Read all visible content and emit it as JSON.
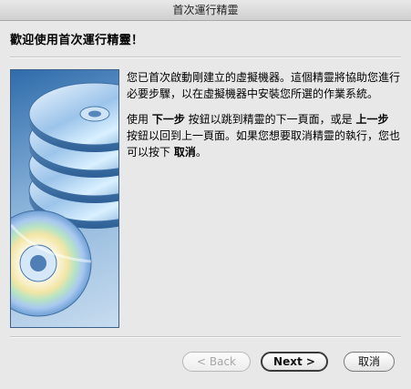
{
  "window": {
    "title": "首次運行精靈"
  },
  "header": {
    "title": "歡迎使用首次運行精靈！"
  },
  "body": {
    "paragraph1": "您已首次啟動剛建立的虛擬機器。這個精靈將協助您進行必要步驟，以在虛擬機器中安裝您所選的作業系統。",
    "p2_part1": "使用 ",
    "p2_bold1": "下一步",
    "p2_part2": " 按鈕以跳到精靈的下一頁面，或是 ",
    "p2_bold2": "上一步",
    "p2_part3": " 按鈕以回到上一頁面。如果您想要取消精靈的執行，您也可以按下 ",
    "p2_bold3": "取消",
    "p2_part4": "。"
  },
  "buttons": {
    "back": "< Back",
    "next": "Next >",
    "cancel": "取消"
  },
  "colors": {
    "accent": "#2f6cab",
    "artwork_light": "#c7dcef"
  }
}
